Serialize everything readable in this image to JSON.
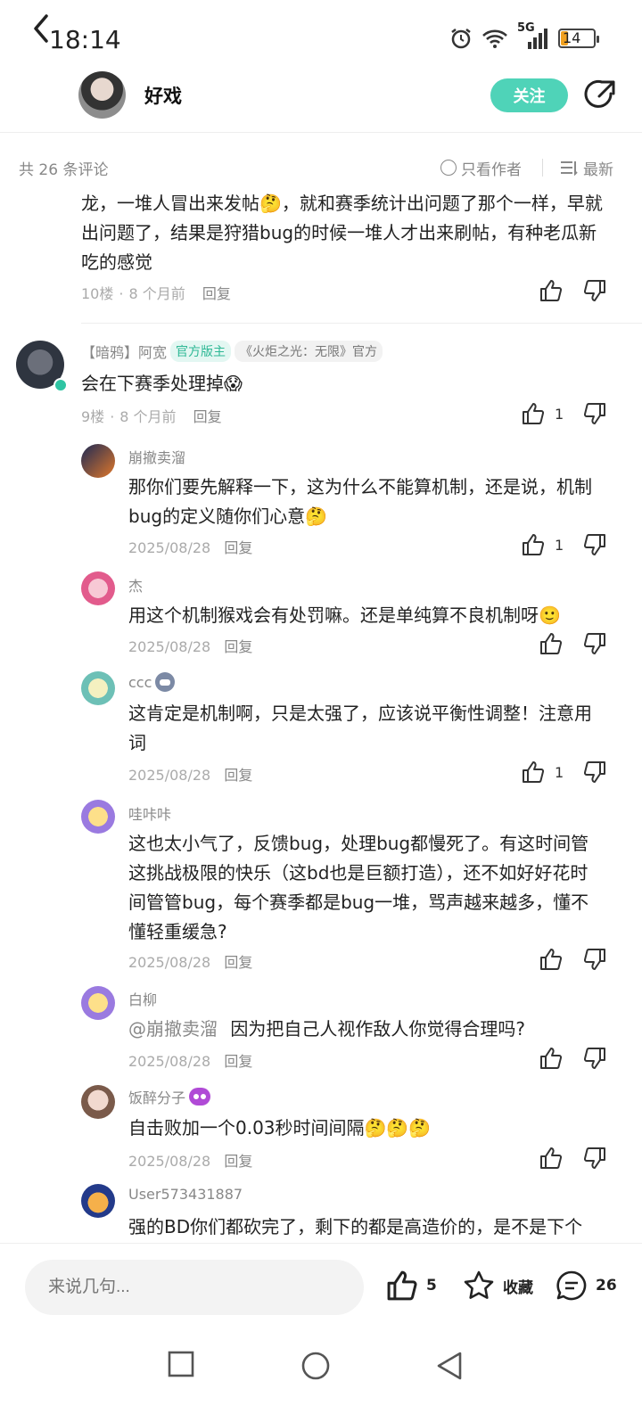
{
  "status": {
    "time": "18:14",
    "battery": "14",
    "network": "5G"
  },
  "header": {
    "title": "好戏",
    "follow_label": "关注"
  },
  "filter": {
    "count_label": "共 26 条评论",
    "author_only_label": "只看作者",
    "sort_label": "最新"
  },
  "comments": [
    {
      "text": "龙，一堆人冒出来发帖🤔，就和赛季统计出问题了那个一样，早就出问题了，结果是狩猎bug的时候一堆人才出来刷帖，有种老瓜新吃的感觉",
      "floor": "10楼",
      "time": "8 个月前",
      "reply": "回复",
      "likes": ""
    },
    {
      "name": "【暗鸦】阿宽",
      "badge1": "官方版主",
      "badge2": "《火炬之光：无限》官方",
      "text": "会在下赛季处理掉😱",
      "floor": "9楼",
      "time": "8 个月前",
      "reply": "回复",
      "likes": "1"
    }
  ],
  "replies": [
    {
      "name": "崩撤卖溜",
      "text": "那你们要先解释一下，这为什么不能算机制，还是说，机制bug的定义随你们心意🤔",
      "date": "2025/08/28",
      "reply": "回复",
      "likes": "1"
    },
    {
      "name": "杰",
      "text": "用这个机制猴戏会有处罚嘛。还是单纯算不良机制呀🙂",
      "date": "2025/08/28",
      "reply": "回复",
      "likes": ""
    },
    {
      "name": "ccc",
      "text": "这肯定是机制啊，只是太强了，应该说平衡性调整！注意用词",
      "date": "2025/08/28",
      "reply": "回复",
      "likes": "1"
    },
    {
      "name": "哇咔咔",
      "text": "这也太小气了，反馈bug，处理bug都慢死了。有这时间管这挑战极限的快乐（这bd也是巨额打造），还不如好好花时间管管bug，每个赛季都是bug一堆，骂声越来越多，懂不懂轻重缓急?",
      "date": "2025/08/28",
      "reply": "回复",
      "likes": ""
    },
    {
      "name": "白柳",
      "mention": "@崩撤卖溜",
      "text": "因为把自己人视作敌人你觉得合理吗?",
      "date": "2025/08/28",
      "reply": "回复",
      "likes": ""
    },
    {
      "name": "饭醉分子",
      "text": "自击败加一个0.03秒时间间隔🤔🤔🤔",
      "date": "2025/08/28",
      "reply": "回复",
      "likes": ""
    },
    {
      "name": "User573431887",
      "text": "强的BD你们都砍完了，剩下的都是高造价的，是不是下个",
      "date": "",
      "reply": "",
      "likes": ""
    }
  ],
  "bottom": {
    "input_placeholder": "来说几句...",
    "like_count": "5",
    "collect_label": "收藏",
    "comment_count": "26"
  }
}
